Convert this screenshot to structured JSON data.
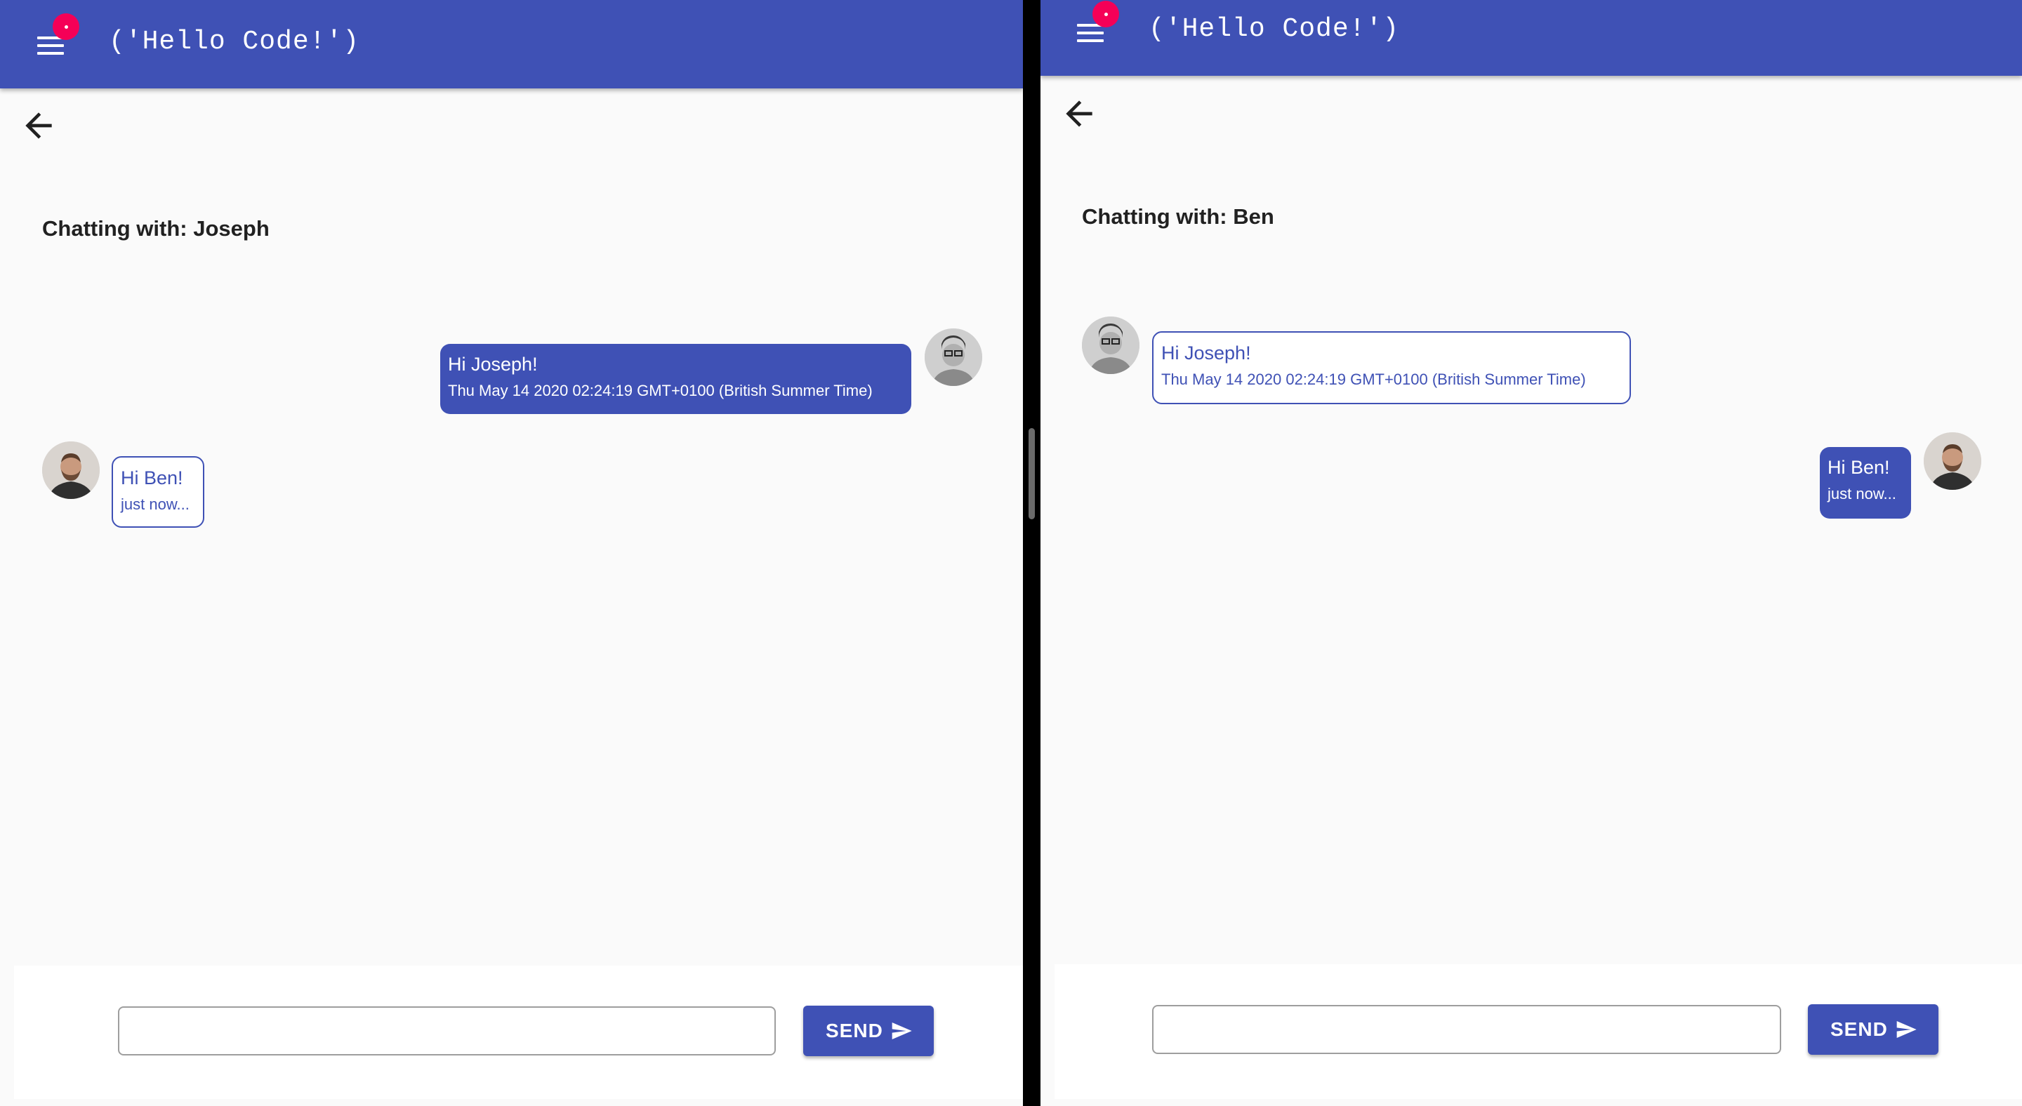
{
  "left_window": {
    "app_title": "('Hello Code!')",
    "menu_icon": "menu-icon",
    "back_icon": "arrow-back-icon",
    "chat_heading": "Chatting with: Joseph",
    "messages": [
      {
        "text": "Hi Joseph!",
        "time": "Thu May 14 2020 02:24:19 GMT+0100 (British Summer Time)",
        "style": "filled",
        "side": "right",
        "avatar": "avatar-joseph"
      },
      {
        "text": "Hi Ben!",
        "time": "just now...",
        "style": "outline",
        "side": "left",
        "avatar": "avatar-ben"
      }
    ],
    "input_value": "",
    "send_label": "SEND",
    "send_icon": "send-icon"
  },
  "right_window": {
    "app_title": "('Hello Code!')",
    "menu_icon": "menu-icon",
    "back_icon": "arrow-back-icon",
    "chat_heading": "Chatting with: Ben",
    "messages": [
      {
        "text": "Hi Joseph!",
        "time": "Thu May 14 2020 02:24:19 GMT+0100 (British Summer Time)",
        "style": "outline",
        "side": "left",
        "avatar": "avatar-joseph"
      },
      {
        "text": "Hi Ben!",
        "time": "just now...",
        "style": "filled",
        "side": "right",
        "avatar": "avatar-ben"
      }
    ],
    "input_value": "",
    "send_label": "SEND",
    "send_icon": "send-icon"
  },
  "colors": {
    "primary": "#3f51b5",
    "accent": "#f50057",
    "background": "#fafafa"
  }
}
